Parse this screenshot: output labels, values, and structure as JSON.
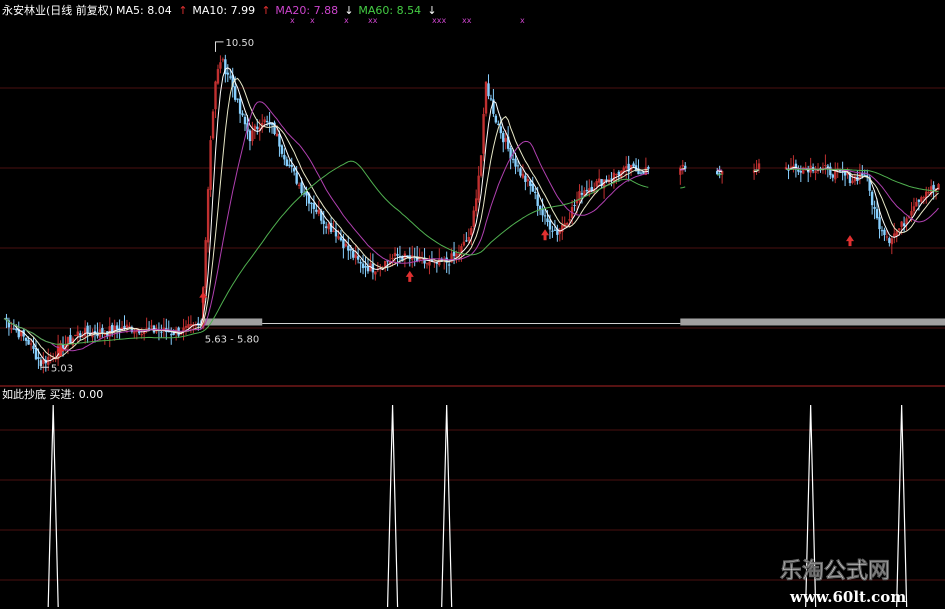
{
  "main_panel": {
    "stock_title": "永安林业(日线 前复权)",
    "ma_legend": [
      {
        "label": "MA5: 8.04",
        "color": "#ffffff",
        "arrow": "up"
      },
      {
        "label": "MA10: 7.99",
        "color": "#ffffff",
        "arrow": "up"
      },
      {
        "label": "MA20: 7.88",
        "color": "#cc44cc",
        "arrow": "down"
      },
      {
        "label": "MA60: 8.54",
        "color": "#44cc44",
        "arrow": "down"
      }
    ],
    "annotations": {
      "high": "10.50",
      "low": "5.03",
      "range": "5.63 - 5.80"
    }
  },
  "sub_panel": {
    "indicator_label": "如此抄底  买进: 0.00"
  },
  "watermark": {
    "title": "乐淘公式网",
    "url": "www.60lt.com"
  },
  "colors": {
    "background": "#000000",
    "up_candle": "#c03030",
    "down_candle": "#88d0ff",
    "ma5": "#ffffff",
    "ma10": "#e8e8c8",
    "ma20": "#b040b0",
    "ma60": "#50b050",
    "divider": "#8a1e1e",
    "grid": "#4a1010",
    "spike": "#ffffff",
    "band": "#a0a0a0"
  },
  "chart_data": [
    {
      "type": "candlestick",
      "title": "永安林业(日线 前复权)",
      "ylim": [
        4.9,
        10.7
      ],
      "annotations": {
        "high": 10.5,
        "low": 5.03,
        "range": [
          5.63,
          5.8
        ]
      },
      "series": [
        {
          "name": "MA5",
          "last": 8.04
        },
        {
          "name": "MA10",
          "last": 7.99
        },
        {
          "name": "MA20",
          "last": 7.88
        },
        {
          "name": "MA60",
          "last": 8.54
        }
      ],
      "key_close_path": [
        [
          0,
          5.85
        ],
        [
          10,
          5.45
        ],
        [
          15,
          5.1
        ],
        [
          20,
          5.25
        ],
        [
          30,
          5.6
        ],
        [
          40,
          5.62
        ],
        [
          50,
          5.7
        ],
        [
          60,
          5.65
        ],
        [
          70,
          5.62
        ],
        [
          80,
          5.72
        ],
        [
          82,
          7.2
        ],
        [
          84,
          8.9
        ],
        [
          86,
          9.8
        ],
        [
          88,
          10.2
        ],
        [
          92,
          9.9
        ],
        [
          96,
          9.3
        ],
        [
          100,
          8.9
        ],
        [
          105,
          9.2
        ],
        [
          110,
          9.0
        ],
        [
          115,
          8.5
        ],
        [
          120,
          8.1
        ],
        [
          125,
          7.8
        ],
        [
          130,
          7.5
        ],
        [
          135,
          7.3
        ],
        [
          140,
          7.0
        ],
        [
          145,
          6.75
        ],
        [
          150,
          6.7
        ],
        [
          155,
          6.8
        ],
        [
          160,
          6.9
        ],
        [
          165,
          6.85
        ],
        [
          170,
          6.8
        ],
        [
          175,
          6.75
        ],
        [
          180,
          6.8
        ],
        [
          185,
          6.95
        ],
        [
          190,
          7.3
        ],
        [
          194,
          8.6
        ],
        [
          196,
          9.8
        ],
        [
          200,
          9.2
        ],
        [
          205,
          8.7
        ],
        [
          210,
          8.3
        ],
        [
          215,
          8.0
        ],
        [
          220,
          7.5
        ],
        [
          225,
          7.3
        ],
        [
          230,
          7.6
        ],
        [
          235,
          8.0
        ],
        [
          240,
          8.1
        ],
        [
          245,
          8.2
        ],
        [
          250,
          8.3
        ],
        [
          255,
          8.35
        ],
        [
          260,
          8.35
        ],
        [
          290,
          8.35
        ],
        [
          330,
          8.4
        ],
        [
          345,
          8.2
        ],
        [
          350,
          8.3
        ],
        [
          355,
          7.5
        ],
        [
          360,
          7.2
        ],
        [
          365,
          7.4
        ],
        [
          370,
          7.8
        ],
        [
          375,
          8.0
        ],
        [
          380,
          8.04
        ]
      ]
    },
    {
      "type": "line",
      "title": "如此抄底",
      "series": [
        {
          "name": "买进",
          "last": 0.0
        }
      ],
      "ylim": [
        0,
        1
      ],
      "signal_bars": [
        20,
        158,
        180,
        328,
        365
      ],
      "values_at_signals": [
        1,
        1,
        1,
        1,
        1
      ]
    }
  ]
}
